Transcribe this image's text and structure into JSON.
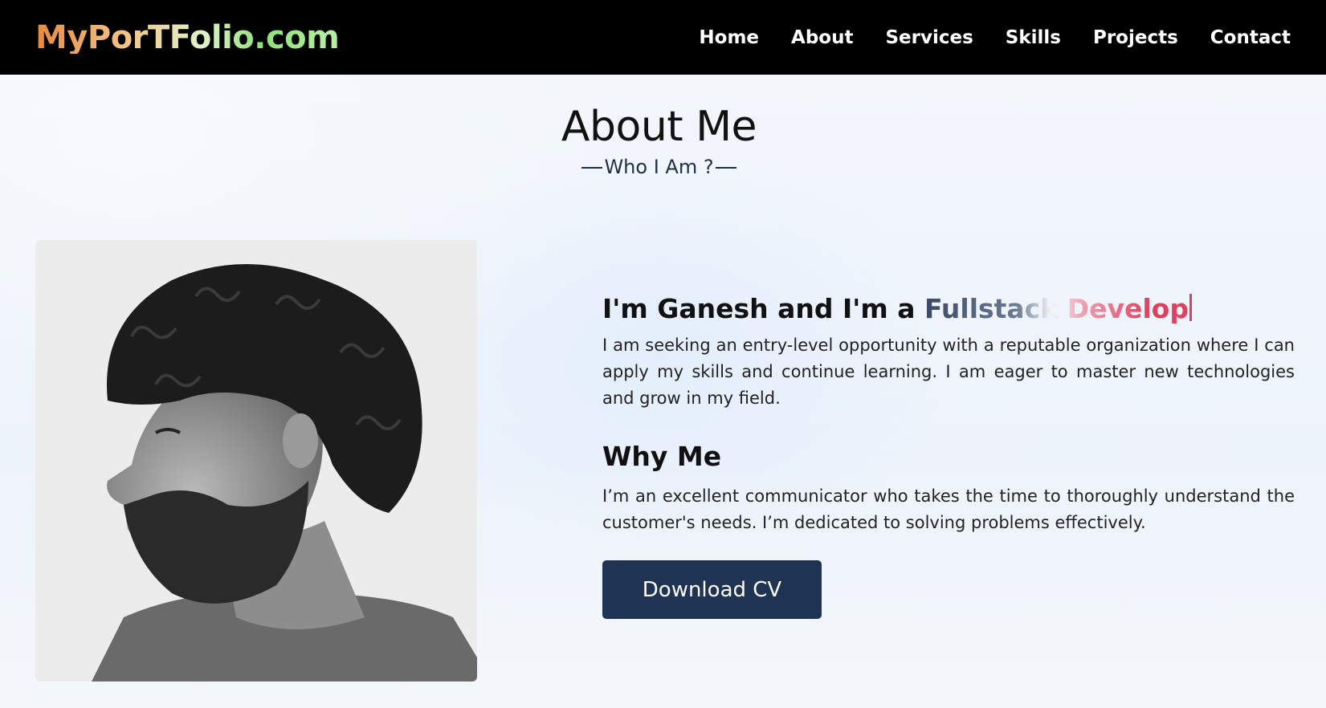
{
  "header": {
    "logo": "MyPorTFolio.com",
    "nav": [
      "Home",
      "About",
      "Services",
      "Skills",
      "Projects",
      "Contact"
    ]
  },
  "about": {
    "title": "About Me",
    "subtitle": "Who I Am ?",
    "intro_prefix": "I'm Ganesh and I'm a ",
    "typed_text": "Fullstack Develop",
    "description": "I am seeking an entry-level opportunity with a reputable organization where I can apply my skills and continue learning. I am eager to master new technologies and grow in my field.",
    "why_title": "Why Me",
    "why_text": "I’m an excellent communicator who takes the time to thoroughly understand the customer's needs. I’m dedicated to solving problems effectively.",
    "button_label": "Download CV"
  },
  "colors": {
    "header_bg": "#000000",
    "button_bg": "#1f3352",
    "accent_pink": "#e0405f"
  }
}
